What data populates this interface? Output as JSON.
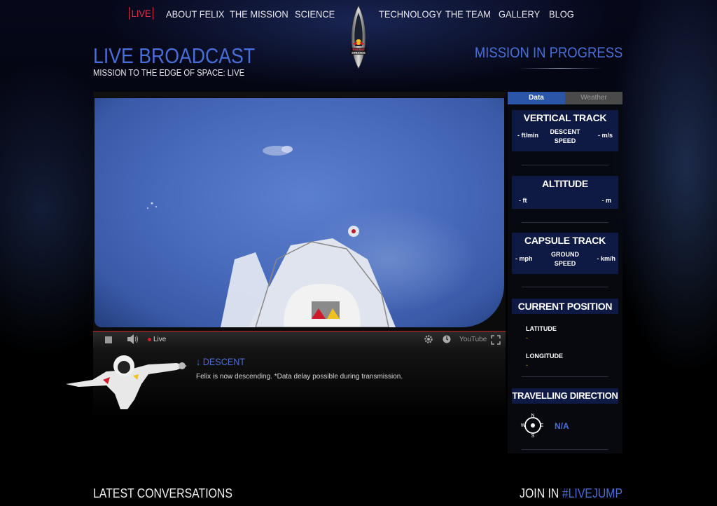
{
  "nav": {
    "items": [
      {
        "label": "LIVE",
        "active": true
      },
      {
        "label": "ABOUT FELIX"
      },
      {
        "label": "THE MISSION"
      },
      {
        "label": "SCIENCE"
      },
      {
        "label": "TECHNOLOGY"
      },
      {
        "label": "THE TEAM"
      },
      {
        "label": "GALLERY"
      },
      {
        "label": "BLOG"
      }
    ],
    "logo": {
      "brand": "Red Bull",
      "product": "STRATOS"
    }
  },
  "header": {
    "title": "LIVE BROADCAST",
    "subtitle": "MISSION TO THE EDGE OF SPACE: LIVE",
    "status": "MISSION IN PROGRESS"
  },
  "player": {
    "live_label": "Live",
    "youtube_label": "YouTube"
  },
  "status_panel": {
    "title": "DESCENT",
    "message": "Felix is now descending. *Data delay possible during transmission."
  },
  "sidebar": {
    "tabs": [
      {
        "label": "Data",
        "active": true
      },
      {
        "label": "Weather"
      }
    ],
    "vertical_track": {
      "title": "VERTICAL TRACK",
      "left": "- ft/min",
      "center_line1": "DESCENT",
      "center_line2": "SPEED",
      "right": "- m/s"
    },
    "altitude": {
      "title": "ALTITUDE",
      "left": "- ft",
      "right": "- m"
    },
    "capsule_track": {
      "title": "CAPSULE TRACK",
      "left": "- mph",
      "center_line1": "GROUND",
      "center_line2": "SPEED",
      "right": "- km/h"
    },
    "current_position": {
      "title": "CURRENT POSITION",
      "latitude_label": "LATITUDE",
      "latitude_value": "-",
      "longitude_label": "LONGITUDE",
      "longitude_value": "-"
    },
    "travelling_direction": {
      "title": "TRAVELLING DIRECTION",
      "value": "N/A",
      "compass": {
        "n": "N",
        "e": "E",
        "s": "S",
        "w": "W"
      }
    }
  },
  "footer": {
    "latest": "LATEST CONVERSATIONS",
    "join_prefix": "JOIN IN",
    "join_tag": "#LIVEJUMP"
  },
  "colors": {
    "accent": "#4a6ed8",
    "live": "#e0304a",
    "panel": "#0e1a44",
    "tab_active": "#2b56a8"
  }
}
